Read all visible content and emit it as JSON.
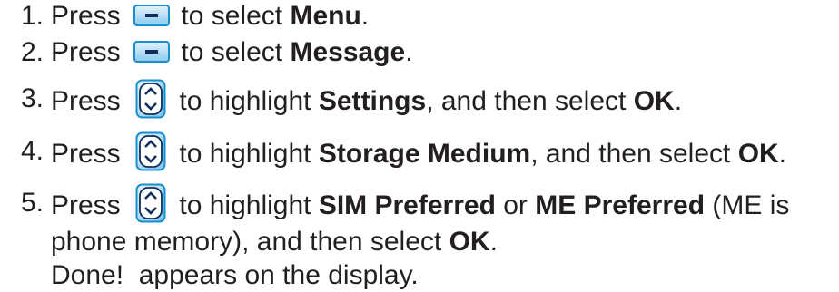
{
  "steps": [
    {
      "num": "1.",
      "parts": [
        "Press",
        "to select",
        "Menu",
        "."
      ]
    },
    {
      "num": "2.",
      "parts": [
        "Press",
        "to select",
        "Message",
        "."
      ]
    },
    {
      "num": "3.",
      "parts": [
        "Press",
        "to highlight",
        "Settings",
        ", and then select",
        "OK",
        "."
      ]
    },
    {
      "num": "4.",
      "parts": [
        "Press",
        "to highlight",
        "Storage Medium",
        ", and then select",
        "OK",
        "."
      ]
    },
    {
      "num": "5.",
      "parts": [
        "Press",
        "to highlight",
        "SIM Preferred",
        "or",
        "ME Preferred",
        "(ME is"
      ]
    }
  ],
  "step5_cont": [
    "phone memory), and then select",
    "OK",
    "."
  ],
  "done_line": "Done!  appears on the display.",
  "icons": {
    "softkey": "soft-key-icon",
    "navkey": "navigation-key-icon"
  },
  "colors": {
    "text": "#231f20",
    "icon_border": "#1a8fd0",
    "icon_fill_start": "#d8eef9",
    "icon_fill_end": "#7cc3ea",
    "icon_mark": "#0f2e5c"
  }
}
